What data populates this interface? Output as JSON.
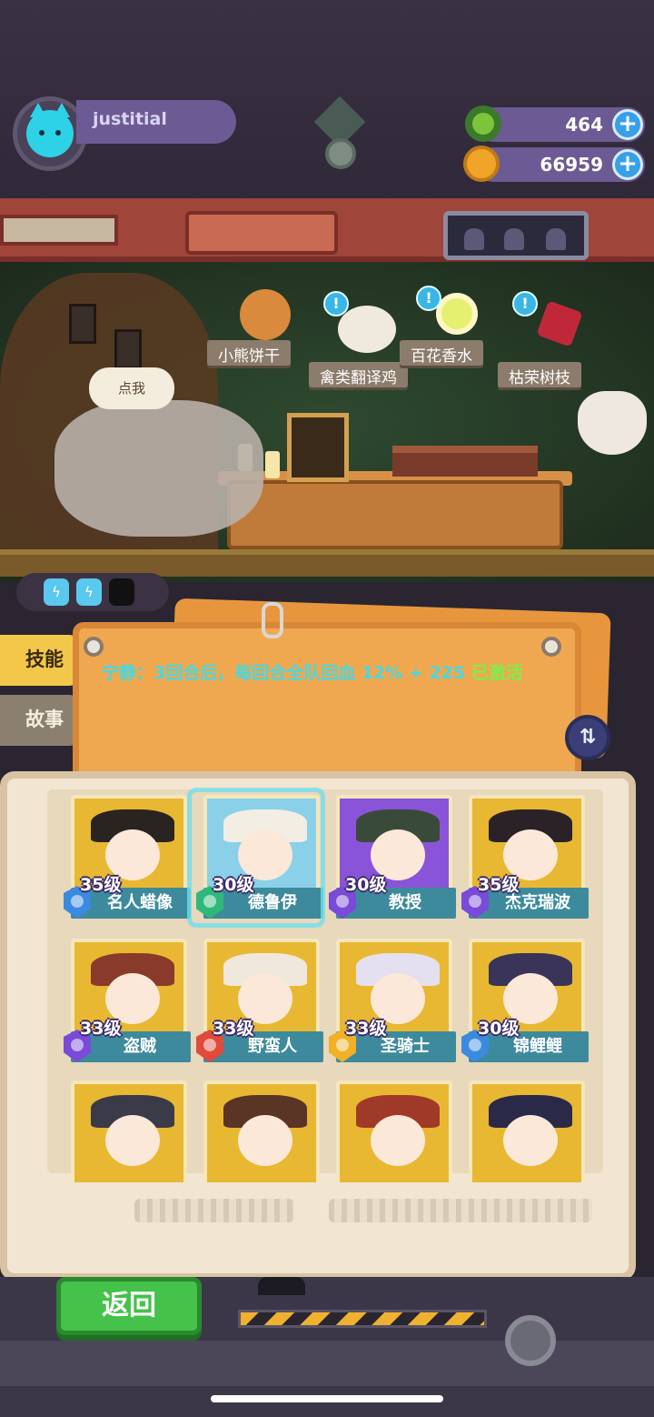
{
  "player": {
    "name": "justitial"
  },
  "resources": [
    {
      "icon": "donut-coin-icon",
      "value": "464",
      "color": "#7cc43a"
    },
    {
      "icon": "planet-coin-icon",
      "value": "66959",
      "color": "#f0a428"
    }
  ],
  "shop": {
    "speech": "点我",
    "items": [
      {
        "label": "小熊饼干"
      },
      {
        "label": "禽类翻译鸡"
      },
      {
        "label": "百花香水"
      },
      {
        "label": "枯荣树枝"
      }
    ]
  },
  "tabs": {
    "skill": "技能",
    "story": "故事"
  },
  "skill": {
    "text": "宁静：3回合后，每回合全队回血 12% + 225 ",
    "status": "已激活"
  },
  "heroes": [
    {
      "level": "35级",
      "name": "名人蜡像",
      "class_color": "#3a8ae0",
      "portrait_color": "#e8b832",
      "hat_color": "#2a2420"
    },
    {
      "level": "30级",
      "name": "德鲁伊",
      "class_color": "#2fb87a",
      "portrait_color": "#8ad0e8",
      "hat_color": "#f2eee4"
    },
    {
      "level": "30级",
      "name": "教授",
      "class_color": "#7a4ad8",
      "portrait_color": "#8a54d8",
      "hat_color": "#3a4a3a"
    },
    {
      "level": "35级",
      "name": "杰克瑞波",
      "class_color": "#7a4ad8",
      "portrait_color": "#e8b832",
      "hat_color": "#2a2226"
    },
    {
      "level": "33级",
      "name": "盗贼",
      "class_color": "#7a4ad8",
      "portrait_color": "#e8b832",
      "hat_color": "#8a3a2a"
    },
    {
      "level": "33级",
      "name": "野蛮人",
      "class_color": "#e04a3a",
      "portrait_color": "#e8b832",
      "hat_color": "#f0e8dc"
    },
    {
      "level": "33级",
      "name": "圣骑士",
      "class_color": "#f0b028",
      "portrait_color": "#e8b832",
      "hat_color": "#e4e0f0"
    },
    {
      "level": "30级",
      "name": "锦鲤鲤",
      "class_color": "#3a8ae0",
      "portrait_color": "#e8b832",
      "hat_color": "#3a3458"
    },
    {
      "level": "",
      "name": "",
      "class_color": "#7a4ad8",
      "portrait_color": "#e8b832",
      "hat_color": "#3a3a48"
    },
    {
      "level": "",
      "name": "",
      "class_color": "#7a4ad8",
      "portrait_color": "#e8b832",
      "hat_color": "#5a3424"
    },
    {
      "level": "",
      "name": "",
      "class_color": "#7a4ad8",
      "portrait_color": "#e8b832",
      "hat_color": "#a03a28"
    },
    {
      "level": "",
      "name": "",
      "class_color": "#7a4ad8",
      "portrait_color": "#e8b832",
      "hat_color": "#2a2a48"
    }
  ],
  "buttons": {
    "back": "返回"
  }
}
